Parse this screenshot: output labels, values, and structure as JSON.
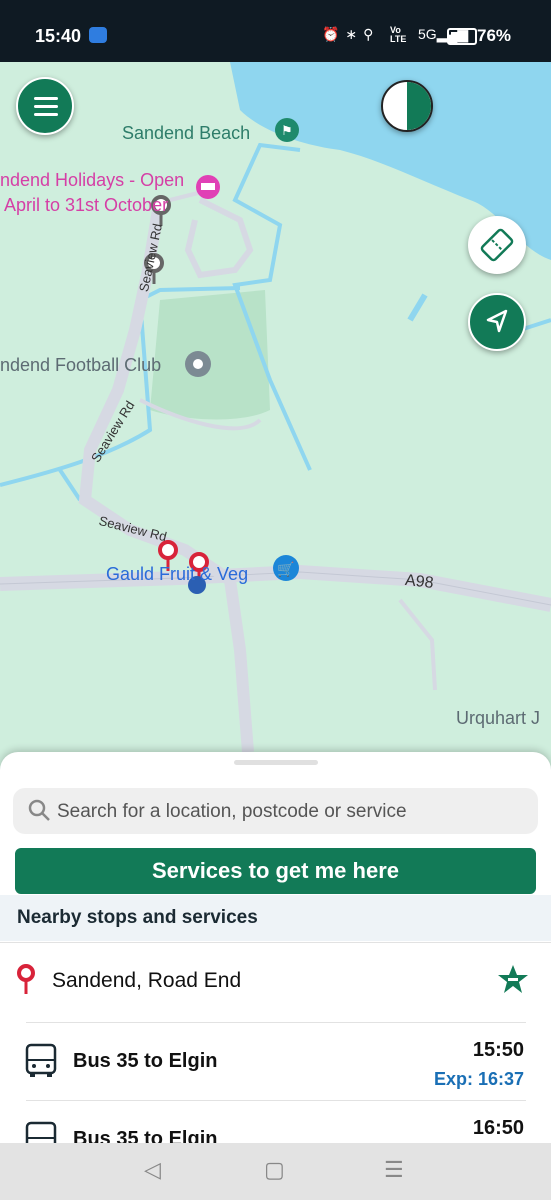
{
  "status_bar": {
    "time": "15:40",
    "volte_line1": "Vo",
    "volte_line2": "LTE",
    "signal": "5G",
    "battery": "76%",
    "battery_level": 0.76
  },
  "map": {
    "labels": {
      "sandend_beach": "Sandend Beach",
      "holidays_line1": "ndend Holidays - Open",
      "holidays_line2": "April to 31st October",
      "football": "ndend Football Club",
      "gauld": "Gauld Fruit & Veg",
      "seaview_1": "Seaview Rd",
      "seaview_2": "Seaview Rd",
      "seaview_3": "Seaview Rd",
      "a98": "A98",
      "urquhart": "Urquhart J"
    },
    "colors": {
      "land": "#cfeedd",
      "water": "#8fd6ef",
      "road": "#d6d9e3",
      "park": "#b8e2c8",
      "accent": "#127a57"
    }
  },
  "buttons": {
    "menu_icon": "hamburger-icon",
    "layer_icon": "layer-toggle-icon",
    "ticket_icon": "ticket-icon",
    "locate_icon": "navigation-arrow-icon"
  },
  "sheet": {
    "search_placeholder": "Search for a location, postcode or service",
    "services_button": "Services to get me here",
    "nearby_title": "Nearby stops and services",
    "stop_name": "Sandend, Road End",
    "services": [
      {
        "title": "Bus 35 to Elgin",
        "time": "15:50",
        "expected": "Exp: 16:37"
      },
      {
        "title": "Bus 35 to Elgin",
        "time": "16:50",
        "expected": ""
      }
    ]
  }
}
